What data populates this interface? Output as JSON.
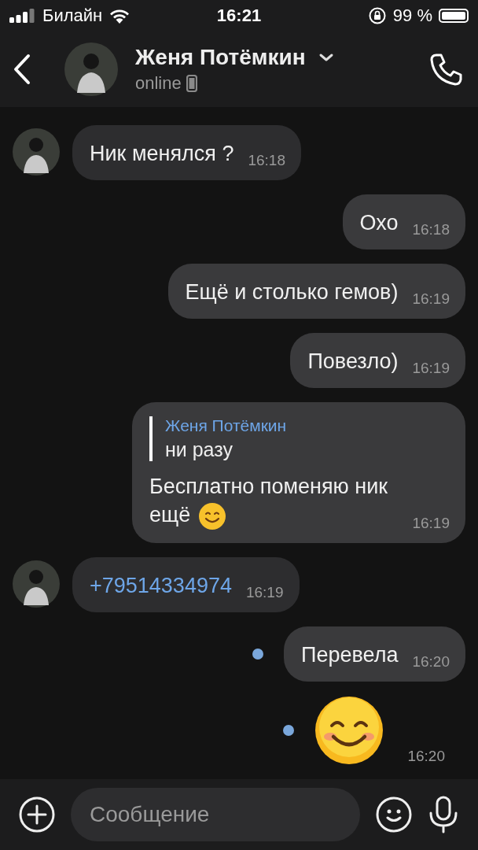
{
  "status_bar": {
    "carrier": "Билайн",
    "time": "16:21",
    "battery": "99 %"
  },
  "header": {
    "name": "Женя Потёмкин",
    "status": "online"
  },
  "messages": [
    {
      "kind": "text",
      "incoming": true,
      "avatar": true,
      "text": "Ник менялся ?",
      "time": "16:18",
      "unread": false
    },
    {
      "kind": "text",
      "incoming": false,
      "avatar": false,
      "text": "Охо",
      "time": "16:18",
      "unread": false
    },
    {
      "kind": "text",
      "incoming": false,
      "avatar": false,
      "text": "Ещё и столько гемов)",
      "time": "16:19",
      "unread": false
    },
    {
      "kind": "text",
      "incoming": false,
      "avatar": false,
      "text": "Повезло)",
      "time": "16:19",
      "unread": false
    },
    {
      "kind": "reply",
      "incoming": false,
      "avatar": false,
      "quote_author": "Женя Потёмкин",
      "quote_text": "ни разу",
      "text": "Бесплатно поменяю ник ещё",
      "emoji": true,
      "time": "16:19",
      "unread": false
    },
    {
      "kind": "phone",
      "incoming": true,
      "avatar": true,
      "text": "+79514334974",
      "time": "16:19",
      "unread": false
    },
    {
      "kind": "text",
      "incoming": false,
      "avatar": false,
      "text": "Перевела",
      "time": "16:20",
      "unread": true
    },
    {
      "kind": "sticker",
      "incoming": false,
      "avatar": false,
      "time": "16:20",
      "unread": true
    }
  ],
  "composer": {
    "placeholder": "Сообщение"
  }
}
